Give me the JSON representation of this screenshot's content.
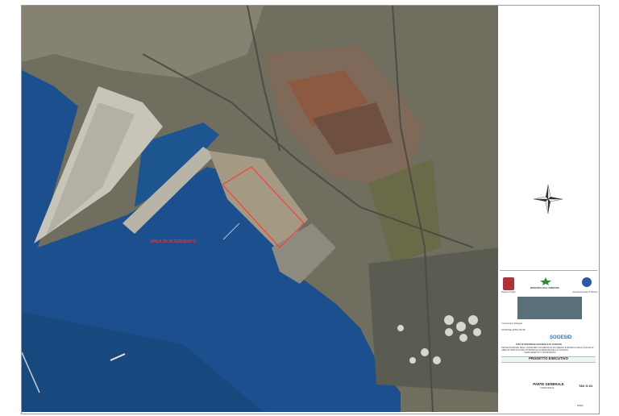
{
  "map": {
    "label": "AREA DI INTERVENTO",
    "colors": {
      "sea": "#1b4f8e",
      "sea_deep": "#174777",
      "land": "#6f6e5f",
      "industrial": "#7f6a5a",
      "pier": "#c8c4b8",
      "boundary": "#ff3a3a"
    }
  },
  "compass": {
    "icon": "compass-rose-icon",
    "letters": [
      "N",
      "E",
      "S",
      "O"
    ]
  },
  "title_block": {
    "header_left": "Regione Puglia",
    "header_mid": "MINISTERO DELL'AMBIENTE",
    "header_right": "Autorità Portuale di Taranto",
    "client": "Commissario Delegato",
    "station": "STAZIONE APPALTANTE",
    "consultant": "SOGESID",
    "site_title": "SITO DI INTERESSE NAZIONALE DI TARANTO",
    "project_line1": "PROGETTAZIONE DEGLI INTERVENTI DI MESSA IN SICUREZZA E BONIFICA DELLA FALDA DI",
    "project_line2": "AREA DI PARTICOLARE POTENZIALE INTERESSE DELLA COLMATA",
    "project_line3": "\"AMPLIAMENTO V SPORGENTE\"",
    "phase": "PROGETTO ESECUTIVO",
    "part": "PARTE GENERALE",
    "subject": "COROGRAFIA",
    "tav": "TAV G.01",
    "footer": "ISTEA"
  }
}
